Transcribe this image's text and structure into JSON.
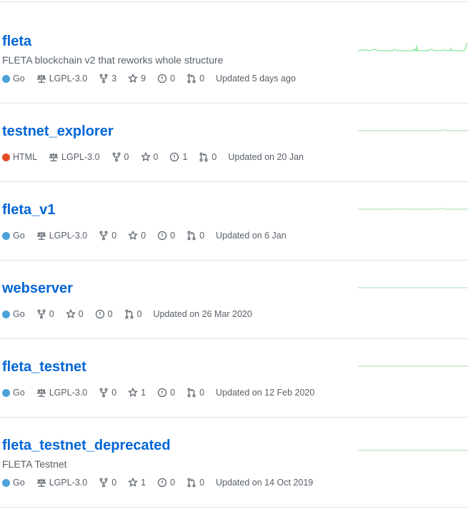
{
  "colors": {
    "link": "#0366d6",
    "go": "#4AA2D9",
    "html": "#E34C26",
    "spark": "#9be9a8"
  },
  "icons": [
    "law-icon",
    "fork-icon",
    "star-icon",
    "issue-icon",
    "pull-request-icon"
  ],
  "repos": [
    {
      "name": "fleta",
      "description": "FLETA blockchain v2 that reworks whole structure",
      "language": "Go",
      "license": "LGPL-3.0",
      "forks": "3",
      "stars": "9",
      "issues": "0",
      "pulls": "0",
      "updated": "Updated 5 days ago"
    },
    {
      "name": "testnet_explorer",
      "description": "",
      "language": "HTML",
      "license": "LGPL-3.0",
      "forks": "0",
      "stars": "0",
      "issues": "1",
      "pulls": "0",
      "updated": "Updated on 20 Jan"
    },
    {
      "name": "fleta_v1",
      "description": "",
      "language": "Go",
      "license": "LGPL-3.0",
      "forks": "0",
      "stars": "0",
      "issues": "0",
      "pulls": "0",
      "updated": "Updated on 6 Jan"
    },
    {
      "name": "webserver",
      "description": "",
      "language": "Go",
      "license": "",
      "forks": "0",
      "stars": "0",
      "issues": "0",
      "pulls": "0",
      "updated": "Updated on 26 Mar 2020"
    },
    {
      "name": "fleta_testnet",
      "description": "",
      "language": "Go",
      "license": "LGPL-3.0",
      "forks": "0",
      "stars": "1",
      "issues": "0",
      "pulls": "0",
      "updated": "Updated on 12 Feb 2020"
    },
    {
      "name": "fleta_testnet_deprecated",
      "description": "FLETA Testnet",
      "language": "Go",
      "license": "LGPL-3.0",
      "forks": "0",
      "stars": "1",
      "issues": "0",
      "pulls": "0",
      "updated": "Updated on 14 Oct 2019"
    }
  ]
}
